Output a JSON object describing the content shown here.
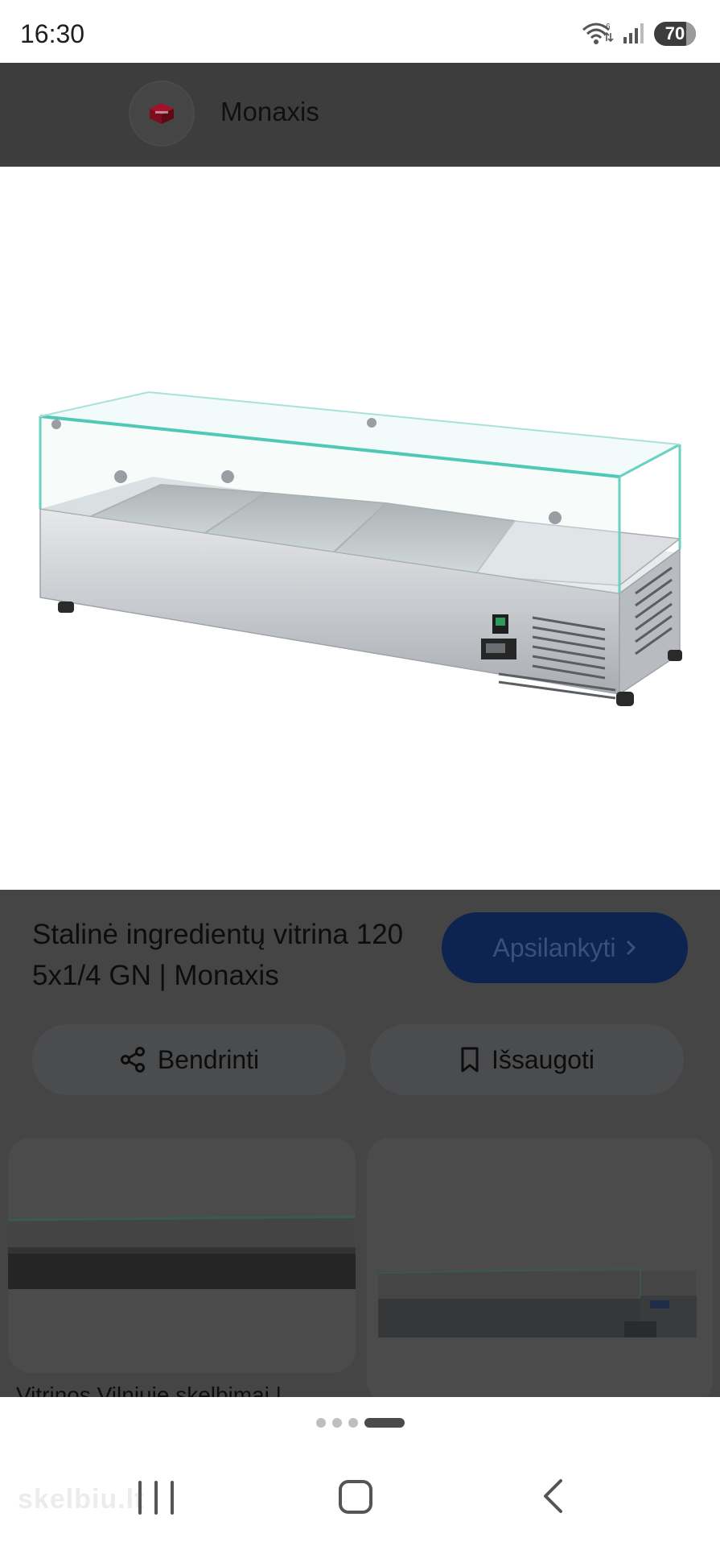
{
  "status_bar": {
    "time": "16:30",
    "battery": "70",
    "wifi_badge": "6"
  },
  "header": {
    "site_name": "Monaxis",
    "logo_icon": "cube-logo-icon"
  },
  "product": {
    "title": "Stalinė ingredientų vitrina 120 5x1/4 GN | Monaxis",
    "visit_label": "Apsilankyti",
    "share_label": "Bendrinti",
    "save_label": "Išsaugoti"
  },
  "related": {
    "caption_1": "Vitrinos Vilniuje skelbimai |"
  },
  "pager": {
    "count": 4,
    "active_index": 3
  },
  "watermark": "skelbiu.lt",
  "colors": {
    "header_bg": "#3d3d3d",
    "overlay_bg": "#454545",
    "visit_button": "#0d2450",
    "glass_edge": "#4fc9b5"
  }
}
